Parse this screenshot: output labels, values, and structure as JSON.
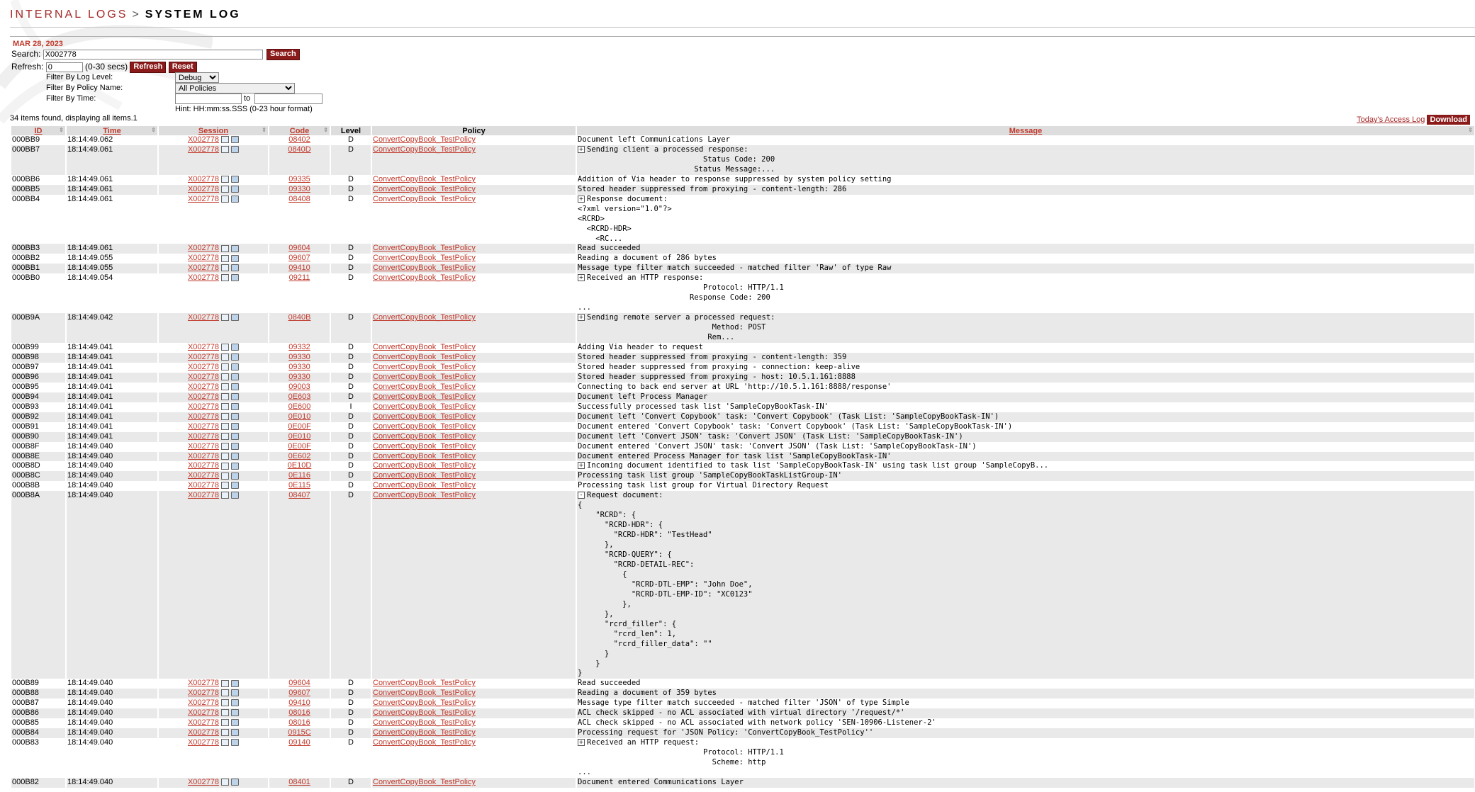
{
  "header": {
    "crumb": "INTERNAL LOGS",
    "sep": ">",
    "title": "SYSTEM LOG"
  },
  "date": "MAR 28, 2023",
  "search": {
    "label": "Search:",
    "value": "X002778",
    "button": "Search"
  },
  "refresh": {
    "label": "Refresh:",
    "value": "0",
    "hint": "(0-30 secs)",
    "button": "Refresh",
    "reset": "Reset"
  },
  "filters": {
    "level_label": "Filter By Log Level:",
    "level_value": "Debug",
    "policy_label": "Filter By Policy Name:",
    "policy_value": "All Policies",
    "time_label": "Filter By Time:",
    "to": "to",
    "hint": "Hint: HH:mm:ss.SSS (0-23 hour format)"
  },
  "count": "34 items found, displaying all items.1",
  "links": {
    "access_log": "Today's Access Log",
    "download": "Download"
  },
  "columns": {
    "id": "ID",
    "time": "Time",
    "session": "Session",
    "code": "Code",
    "level": "Level",
    "policy": "Policy",
    "message": "Message"
  },
  "colors": {
    "accent": "#c0392b",
    "button": "#8b1a1a",
    "row_alt": "#e9e9e9"
  },
  "icons": [
    "monitor-icon",
    "document-icon",
    "expand-icon",
    "collapse-icon"
  ],
  "rows": [
    {
      "id": "000BB9",
      "time": "18:14:49.062",
      "session": "X002778",
      "code": "08402",
      "level": "D",
      "policy": "ConvertCopyBook_TestPolicy",
      "expand": "",
      "lines": [
        "Document left Communications Layer"
      ]
    },
    {
      "id": "000BB7",
      "time": "18:14:49.061",
      "session": "X002778",
      "code": "0840D",
      "level": "D",
      "policy": "ConvertCopyBook_TestPolicy",
      "expand": "+",
      "lines": [
        "Sending client a processed response:",
        "                            Status Code: 200",
        "                          Status Message:..."
      ]
    },
    {
      "id": "000BB6",
      "time": "18:14:49.061",
      "session": "X002778",
      "code": "09335",
      "level": "D",
      "policy": "ConvertCopyBook_TestPolicy",
      "expand": "",
      "lines": [
        "Addition of Via header to response suppressed by system policy setting"
      ]
    },
    {
      "id": "000BB5",
      "time": "18:14:49.061",
      "session": "X002778",
      "code": "09330",
      "level": "D",
      "policy": "ConvertCopyBook_TestPolicy",
      "expand": "",
      "lines": [
        "Stored header suppressed from proxying - content-length: 286"
      ]
    },
    {
      "id": "000BB4",
      "time": "18:14:49.061",
      "session": "X002778",
      "code": "08408",
      "level": "D",
      "policy": "ConvertCopyBook_TestPolicy",
      "expand": "+",
      "lines": [
        "Response document:",
        "<?xml version=\"1.0\"?>",
        "<RCRD>",
        "  <RCRD-HDR>",
        "    <RC..."
      ]
    },
    {
      "id": "000BB3",
      "time": "18:14:49.061",
      "session": "X002778",
      "code": "09604",
      "level": "D",
      "policy": "ConvertCopyBook_TestPolicy",
      "expand": "",
      "lines": [
        "Read succeeded"
      ]
    },
    {
      "id": "000BB2",
      "time": "18:14:49.055",
      "session": "X002778",
      "code": "09607",
      "level": "D",
      "policy": "ConvertCopyBook_TestPolicy",
      "expand": "",
      "lines": [
        "Reading a document of 286 bytes"
      ]
    },
    {
      "id": "000BB1",
      "time": "18:14:49.055",
      "session": "X002778",
      "code": "09410",
      "level": "D",
      "policy": "ConvertCopyBook_TestPolicy",
      "expand": "",
      "lines": [
        "Message type filter match succeeded - matched filter 'Raw' of type Raw"
      ]
    },
    {
      "id": "000BB0",
      "time": "18:14:49.054",
      "session": "X002778",
      "code": "09211",
      "level": "D",
      "policy": "ConvertCopyBook_TestPolicy",
      "expand": "+",
      "lines": [
        "Received an HTTP response:",
        "                            Protocol: HTTP/1.1",
        "                         Response Code: 200",
        "",
        "..."
      ]
    },
    {
      "id": "000B9A",
      "time": "18:14:49.042",
      "session": "X002778",
      "code": "0840B",
      "level": "D",
      "policy": "ConvertCopyBook_TestPolicy",
      "expand": "+",
      "lines": [
        "Sending remote server a processed request:",
        "                              Method: POST",
        "                             Rem..."
      ]
    },
    {
      "id": "000B99",
      "time": "18:14:49.041",
      "session": "X002778",
      "code": "09332",
      "level": "D",
      "policy": "ConvertCopyBook_TestPolicy",
      "expand": "",
      "lines": [
        "Adding Via header to request"
      ]
    },
    {
      "id": "000B98",
      "time": "18:14:49.041",
      "session": "X002778",
      "code": "09330",
      "level": "D",
      "policy": "ConvertCopyBook_TestPolicy",
      "expand": "",
      "lines": [
        "Stored header suppressed from proxying - content-length: 359"
      ]
    },
    {
      "id": "000B97",
      "time": "18:14:49.041",
      "session": "X002778",
      "code": "09330",
      "level": "D",
      "policy": "ConvertCopyBook_TestPolicy",
      "expand": "",
      "lines": [
        "Stored header suppressed from proxying - connection: keep-alive"
      ]
    },
    {
      "id": "000B96",
      "time": "18:14:49.041",
      "session": "X002778",
      "code": "09330",
      "level": "D",
      "policy": "ConvertCopyBook_TestPolicy",
      "expand": "",
      "lines": [
        "Stored header suppressed from proxying - host: 10.5.1.161:8888"
      ]
    },
    {
      "id": "000B95",
      "time": "18:14:49.041",
      "session": "X002778",
      "code": "09003",
      "level": "D",
      "policy": "ConvertCopyBook_TestPolicy",
      "expand": "",
      "lines": [
        "Connecting to back end server at URL 'http://10.5.1.161:8888/response'"
      ]
    },
    {
      "id": "000B94",
      "time": "18:14:49.041",
      "session": "X002778",
      "code": "0E603",
      "level": "D",
      "policy": "ConvertCopyBook_TestPolicy",
      "expand": "",
      "lines": [
        "Document left Process Manager"
      ]
    },
    {
      "id": "000B93",
      "time": "18:14:49.041",
      "session": "X002778",
      "code": "0E600",
      "level": "I",
      "policy": "ConvertCopyBook_TestPolicy",
      "expand": "",
      "lines": [
        "Successfully processed task list 'SampleCopyBookTask-IN'"
      ]
    },
    {
      "id": "000B92",
      "time": "18:14:49.041",
      "session": "X002778",
      "code": "0E010",
      "level": "D",
      "policy": "ConvertCopyBook_TestPolicy",
      "expand": "",
      "lines": [
        "Document left 'Convert Copybook' task: 'Convert Copybook' (Task List: 'SampleCopyBookTask-IN')"
      ]
    },
    {
      "id": "000B91",
      "time": "18:14:49.041",
      "session": "X002778",
      "code": "0E00F",
      "level": "D",
      "policy": "ConvertCopyBook_TestPolicy",
      "expand": "",
      "lines": [
        "Document entered 'Convert Copybook' task: 'Convert Copybook' (Task List: 'SampleCopyBookTask-IN')"
      ]
    },
    {
      "id": "000B90",
      "time": "18:14:49.041",
      "session": "X002778",
      "code": "0E010",
      "level": "D",
      "policy": "ConvertCopyBook_TestPolicy",
      "expand": "",
      "lines": [
        "Document left 'Convert JSON' task: 'Convert JSON' (Task List: 'SampleCopyBookTask-IN')"
      ]
    },
    {
      "id": "000B8F",
      "time": "18:14:49.040",
      "session": "X002778",
      "code": "0E00F",
      "level": "D",
      "policy": "ConvertCopyBook_TestPolicy",
      "expand": "",
      "lines": [
        "Document entered 'Convert JSON' task: 'Convert JSON' (Task List: 'SampleCopyBookTask-IN')"
      ]
    },
    {
      "id": "000B8E",
      "time": "18:14:49.040",
      "session": "X002778",
      "code": "0E602",
      "level": "D",
      "policy": "ConvertCopyBook_TestPolicy",
      "expand": "",
      "lines": [
        "Document entered Process Manager for task list 'SampleCopyBookTask-IN'"
      ]
    },
    {
      "id": "000B8D",
      "time": "18:14:49.040",
      "session": "X002778",
      "code": "0E10D",
      "level": "D",
      "policy": "ConvertCopyBook_TestPolicy",
      "expand": "+",
      "lines": [
        "Incoming document identified to task list 'SampleCopyBookTask-IN' using task list group 'SampleCopyB..."
      ]
    },
    {
      "id": "000B8C",
      "time": "18:14:49.040",
      "session": "X002778",
      "code": "0E116",
      "level": "D",
      "policy": "ConvertCopyBook_TestPolicy",
      "expand": "",
      "lines": [
        "Processing task list group 'SampleCopyBookTaskListGroup-IN'"
      ]
    },
    {
      "id": "000B8B",
      "time": "18:14:49.040",
      "session": "X002778",
      "code": "0E115",
      "level": "D",
      "policy": "ConvertCopyBook_TestPolicy",
      "expand": "",
      "lines": [
        "Processing task list group for Virtual Directory Request"
      ]
    },
    {
      "id": "000B8A",
      "time": "18:14:49.040",
      "session": "X002778",
      "code": "08407",
      "level": "D",
      "policy": "ConvertCopyBook_TestPolicy",
      "expand": "-",
      "lines": [
        "Request document:",
        "{",
        "    \"RCRD\": {",
        "      \"RCRD-HDR\": {",
        "        \"RCRD-HDR\": \"TestHead\"",
        "      },",
        "      \"RCRD-QUERY\": {",
        "        \"RCRD-DETAIL-REC\":",
        "          {",
        "            \"RCRD-DTL-EMP\": \"John Doe\",",
        "            \"RCRD-DTL-EMP-ID\": \"XC0123\"",
        "          },",
        "",
        "",
        "      },",
        "      \"rcrd_filler\": {",
        "        \"rcrd_len\": 1,",
        "        \"rcrd_filler_data\": \"\"",
        "      }",
        "    }",
        "}"
      ]
    },
    {
      "id": "000B89",
      "time": "18:14:49.040",
      "session": "X002778",
      "code": "09604",
      "level": "D",
      "policy": "ConvertCopyBook_TestPolicy",
      "expand": "",
      "lines": [
        "Read succeeded"
      ]
    },
    {
      "id": "000B88",
      "time": "18:14:49.040",
      "session": "X002778",
      "code": "09607",
      "level": "D",
      "policy": "ConvertCopyBook_TestPolicy",
      "expand": "",
      "lines": [
        "Reading a document of 359 bytes"
      ]
    },
    {
      "id": "000B87",
      "time": "18:14:49.040",
      "session": "X002778",
      "code": "09410",
      "level": "D",
      "policy": "ConvertCopyBook_TestPolicy",
      "expand": "",
      "lines": [
        "Message type filter match succeeded - matched filter 'JSON' of type Simple"
      ]
    },
    {
      "id": "000B86",
      "time": "18:14:49.040",
      "session": "X002778",
      "code": "08016",
      "level": "D",
      "policy": "ConvertCopyBook_TestPolicy",
      "expand": "",
      "lines": [
        "ACL check skipped - no ACL associated with virtual directory '/request/*'"
      ]
    },
    {
      "id": "000B85",
      "time": "18:14:49.040",
      "session": "X002778",
      "code": "08016",
      "level": "D",
      "policy": "ConvertCopyBook_TestPolicy",
      "expand": "",
      "lines": [
        "ACL check skipped - no ACL associated with network policy 'SEN-10906-Listener-2'"
      ]
    },
    {
      "id": "000B84",
      "time": "18:14:49.040",
      "session": "X002778",
      "code": "0915C",
      "level": "D",
      "policy": "ConvertCopyBook_TestPolicy",
      "expand": "",
      "lines": [
        "Processing request for 'JSON Policy: 'ConvertCopyBook_TestPolicy''"
      ]
    },
    {
      "id": "000B83",
      "time": "18:14:49.040",
      "session": "X002778",
      "code": "09140",
      "level": "D",
      "policy": "ConvertCopyBook_TestPolicy",
      "expand": "+",
      "lines": [
        "Received an HTTP request:",
        "                            Protocol: HTTP/1.1",
        "                              Scheme: http",
        "",
        "..."
      ]
    },
    {
      "id": "000B82",
      "time": "18:14:49.040",
      "session": "X002778",
      "code": "08401",
      "level": "D",
      "policy": "ConvertCopyBook_TestPolicy",
      "expand": "",
      "lines": [
        "Document entered Communications Layer"
      ]
    }
  ]
}
